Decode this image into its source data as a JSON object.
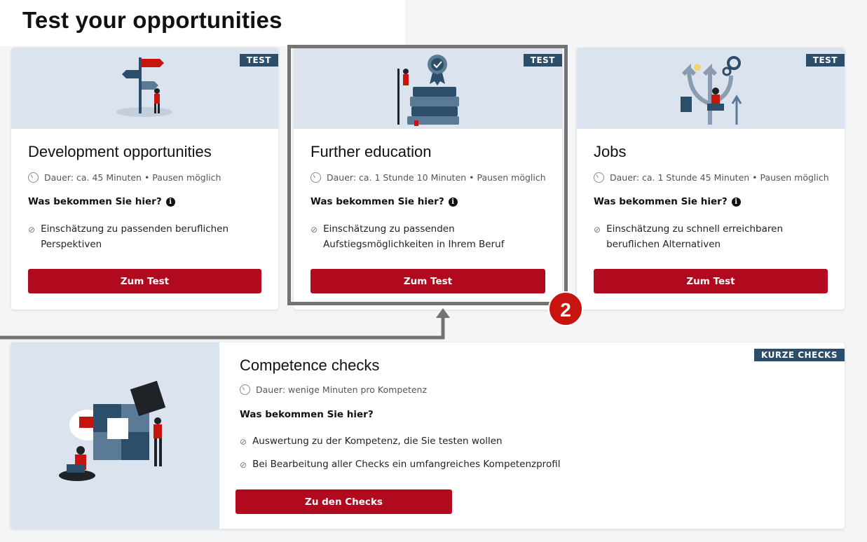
{
  "page": {
    "title": "Test your opportunities"
  },
  "cards": [
    {
      "badge": "TEST",
      "title": "Development opportunities",
      "duration": "Dauer: ca. 45 Minuten • Pausen möglich",
      "what_label": "Was bekommen Sie hier?",
      "benefit_line1": "Einschätzung zu passenden beruflichen",
      "benefit_line2": "Perspektiven",
      "button": "Zum Test"
    },
    {
      "badge": "TEST",
      "title": "Further education",
      "duration": "Dauer: ca. 1 Stunde 10 Minuten • Pausen möglich",
      "what_label": "Was bekommen Sie hier?",
      "benefit_line1": "Einschätzung zu passenden",
      "benefit_line2": "Aufstiegsmöglichkeiten in Ihrem Beruf",
      "button": "Zum Test"
    },
    {
      "badge": "TEST",
      "title": "Jobs",
      "duration": "Dauer: ca. 1 Stunde 45 Minuten • Pausen möglich",
      "what_label": "Was bekommen Sie hier?",
      "benefit_line1": "Einschätzung zu schnell erreichbaren",
      "benefit_line2": "beruflichen Alternativen",
      "button": "Zum Test"
    }
  ],
  "competence": {
    "badge": "KURZE CHECKS",
    "title": "Competence checks",
    "duration": "Dauer: wenige Minuten pro Kompetenz",
    "what_label": "Was bekommen Sie hier?",
    "benefits": [
      "Auswertung zu der Kompetenz, die Sie testen wollen",
      "Bei Bearbeitung aller Checks ein umfangreiches Kompetenzprofil"
    ],
    "button": "Zu den Checks"
  },
  "step_marker": "2",
  "icons": {
    "clock": "clock-icon",
    "info": "info-icon",
    "check": "check-circle-icon"
  },
  "colors": {
    "accent_red": "#b10a1e",
    "badge_blue": "#2c4e6a",
    "illustration_bg": "#dbe3ee",
    "step_red": "#c8140f"
  }
}
